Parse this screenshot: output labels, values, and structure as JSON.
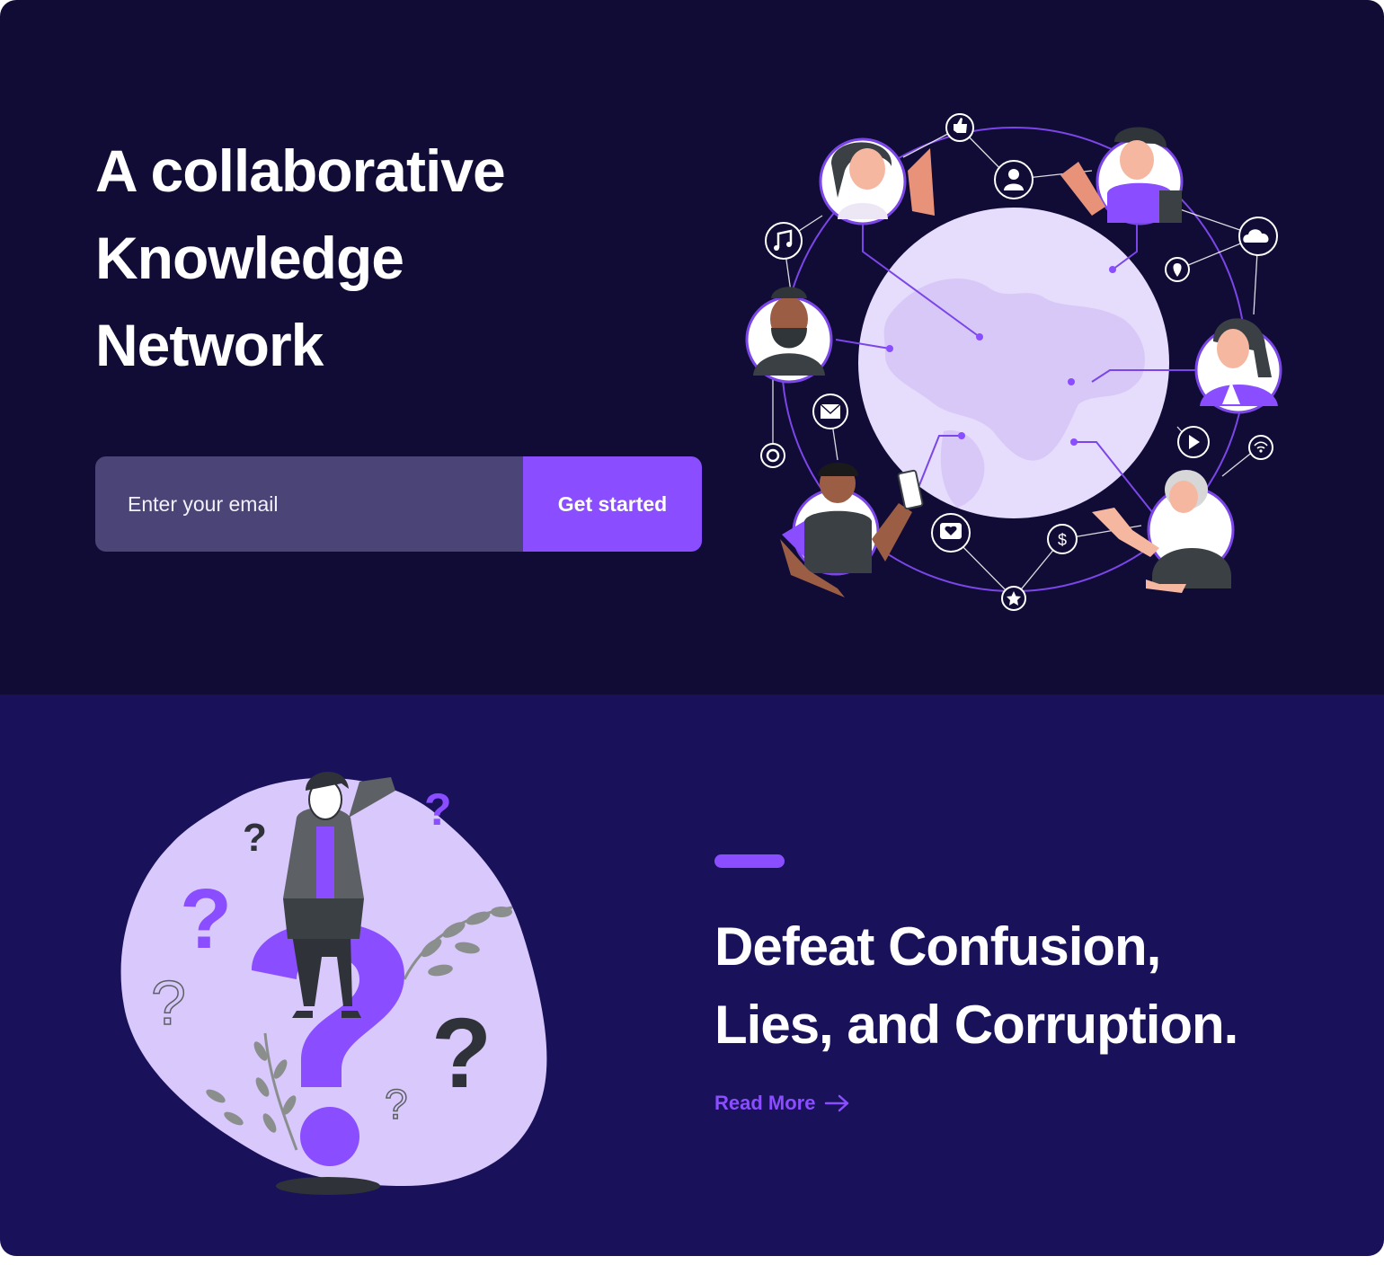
{
  "hero": {
    "title_line1": "A collaborative",
    "title_line2": "Knowledge",
    "title_line3": "Network",
    "email_placeholder": "Enter your email",
    "cta_label": "Get started"
  },
  "feature": {
    "title_line1": "Defeat Confusion,",
    "title_line2": "Lies, and Corruption.",
    "read_more_label": "Read More"
  },
  "icons": {
    "network": [
      "thumbs-up-icon",
      "user-icon",
      "cloud-icon",
      "location-icon",
      "music-icon",
      "mail-icon",
      "settings-icon",
      "play-icon",
      "wifi-icon",
      "heart-message-icon",
      "dollar-icon",
      "star-icon"
    ],
    "arrow": "arrow-right-icon"
  },
  "colors": {
    "hero_background": "#110c35",
    "feature_background": "#19115a",
    "accent": "#8a4dff",
    "input_background": "#4b4476",
    "globe": "#e6dcfb",
    "blob": "#d8c8fb"
  }
}
